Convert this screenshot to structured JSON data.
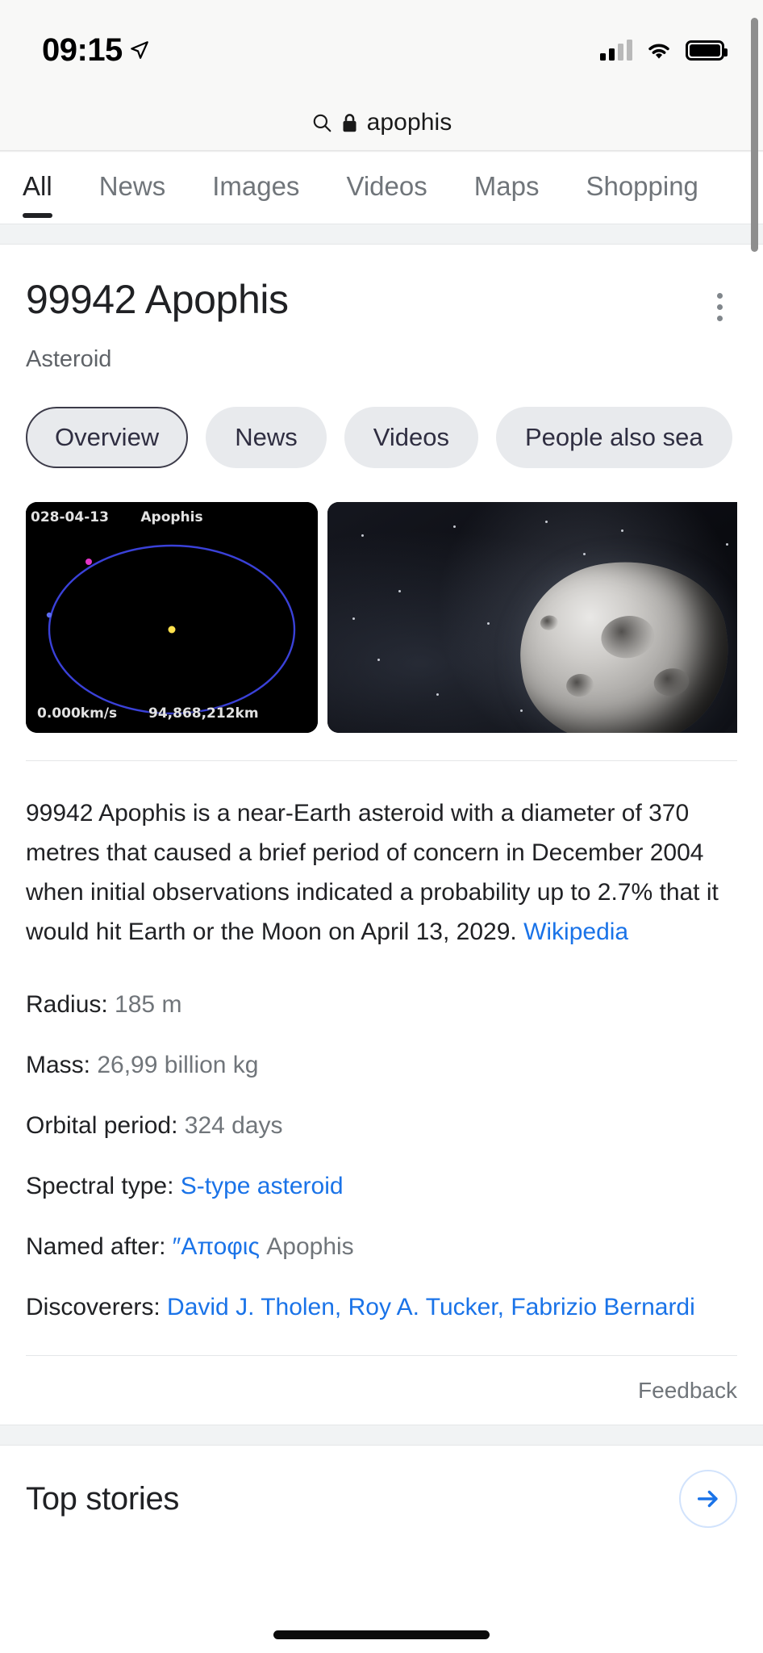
{
  "status_bar": {
    "time": "09:15",
    "location_icon": "location-arrow-icon",
    "signal_icon": "cellular-signal-icon",
    "wifi_icon": "wifi-icon",
    "battery_icon": "battery-full-icon"
  },
  "search": {
    "search_icon": "search-icon",
    "lock_icon": "lock-icon",
    "query": "apophis"
  },
  "nav_tabs": [
    {
      "label": "All",
      "active": true
    },
    {
      "label": "News",
      "active": false
    },
    {
      "label": "Images",
      "active": false
    },
    {
      "label": "Videos",
      "active": false
    },
    {
      "label": "Maps",
      "active": false
    },
    {
      "label": "Shopping",
      "active": false
    }
  ],
  "knowledge_panel": {
    "title": "99942 Apophis",
    "subtitle": "Asteroid",
    "menu_icon": "more-options-kebab-icon",
    "chips": [
      {
        "label": "Overview",
        "selected": true
      },
      {
        "label": "News",
        "selected": false
      },
      {
        "label": "Videos",
        "selected": false
      },
      {
        "label": "People also sea",
        "selected": false
      }
    ],
    "media": {
      "orbit_diagram": {
        "date": "028-04-13",
        "object_name": "Apophis",
        "speed": "0.000km/s",
        "distance": "94,868,212km",
        "orbit_color": "#3a41d8",
        "sun_color": "#ffe14d",
        "marker_color": "#e334c8"
      },
      "asteroid_photo": {
        "alt": "asteroid-render"
      }
    },
    "description": {
      "text_before_link": "99942 Apophis is a near-Earth asteroid with a diameter of 370 metres that caused a brief period of concern in December 2004 when initial observations indicated a probability up to 2.7% that it would hit Earth or the Moon on April 13, 2029. ",
      "link_label": "Wikipedia"
    },
    "facts": [
      {
        "label": "Radius:",
        "value": " 185 m",
        "is_link": false
      },
      {
        "label": "Mass:",
        "value": " 26,99 billion kg",
        "is_link": false
      },
      {
        "label": "Orbital period:",
        "value": " 324 days",
        "is_link": false
      },
      {
        "label": "Spectral type:",
        "value": " S-type asteroid",
        "is_link": true
      },
      {
        "label": "Named after:",
        "value": " ″Αποφις",
        "value2": " Apophis",
        "is_link": true
      },
      {
        "label": "Discoverers:",
        "value": " David J. Tholen, Roy A. Tucker, Fabrizio Bernardi",
        "is_link": true
      }
    ],
    "feedback_label": "Feedback"
  },
  "top_stories": {
    "title": "Top stories",
    "arrow_icon": "arrow-right-icon",
    "arrow_color": "#1a73e8"
  }
}
